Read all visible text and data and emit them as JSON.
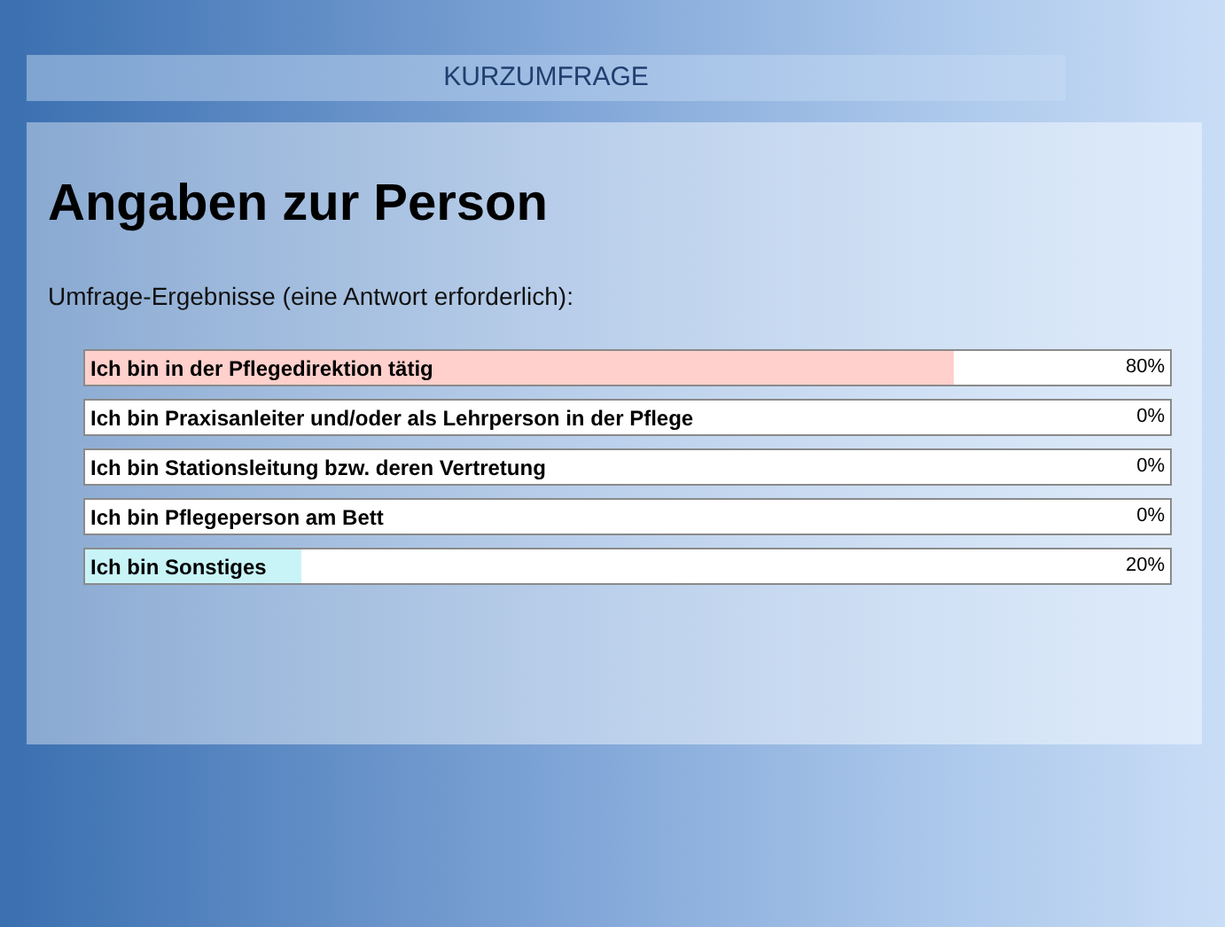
{
  "header": {
    "title": "KURZUMFRAGE"
  },
  "heading": "Angaben zur Person",
  "subtitle": "Umfrage-Ergebnisse (eine Antwort erforderlich):",
  "results": [
    {
      "label": "Ich bin in der Pflegedirektion tätig",
      "level": 0.8,
      "reading": "80%",
      "color": "#ffd0cc"
    },
    {
      "label": "Ich bin Praxisanleiter und/oder als Lehrperson in der Pflege",
      "reading": "0%"
    },
    {
      "label": "Ich bin Stationsleitung bzw. deren Vertretung",
      "reading": "0%"
    },
    {
      "label": "Ich bin Pflegeperson am Bett",
      "reading": "0%"
    },
    {
      "label": "Ich bin Sonstiges",
      "level": 0.2,
      "reading": "20%",
      "color": "#c8f4f8"
    }
  ]
}
